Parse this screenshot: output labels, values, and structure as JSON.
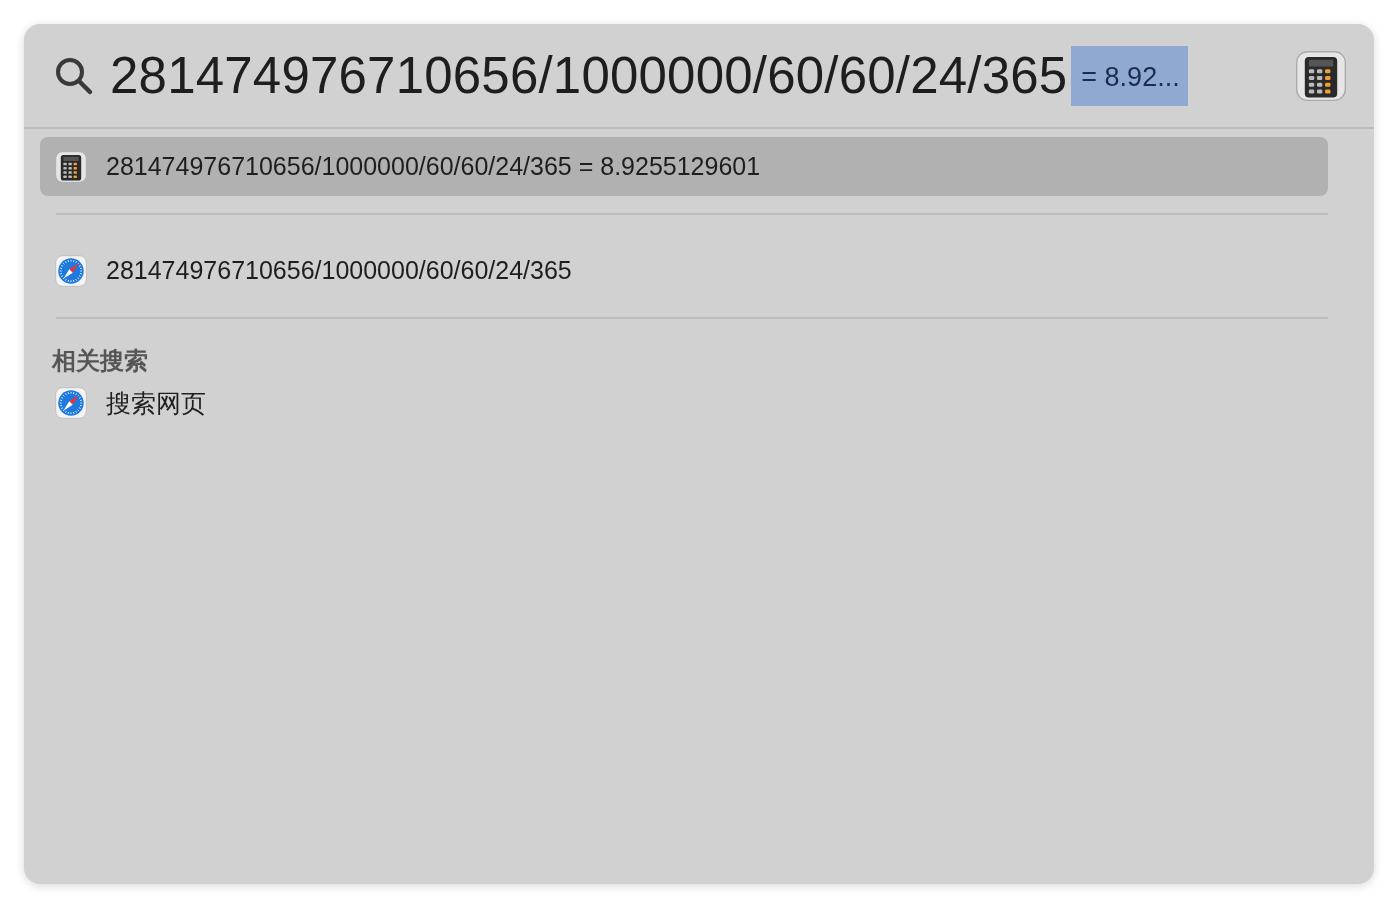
{
  "search": {
    "query": "281474976710656/1000000/60/60/24/365",
    "completion": "= 8.92..."
  },
  "results": [
    {
      "kind": "calculator",
      "label": "281474976710656/1000000/60/60/24/365 = 8.9255129601",
      "selected": true
    },
    {
      "kind": "browser",
      "label": "281474976710656/1000000/60/60/24/365",
      "selected": false
    }
  ],
  "related": {
    "title": "相关搜索",
    "items": [
      {
        "kind": "browser",
        "label": "搜索网页",
        "selected": false
      }
    ]
  }
}
